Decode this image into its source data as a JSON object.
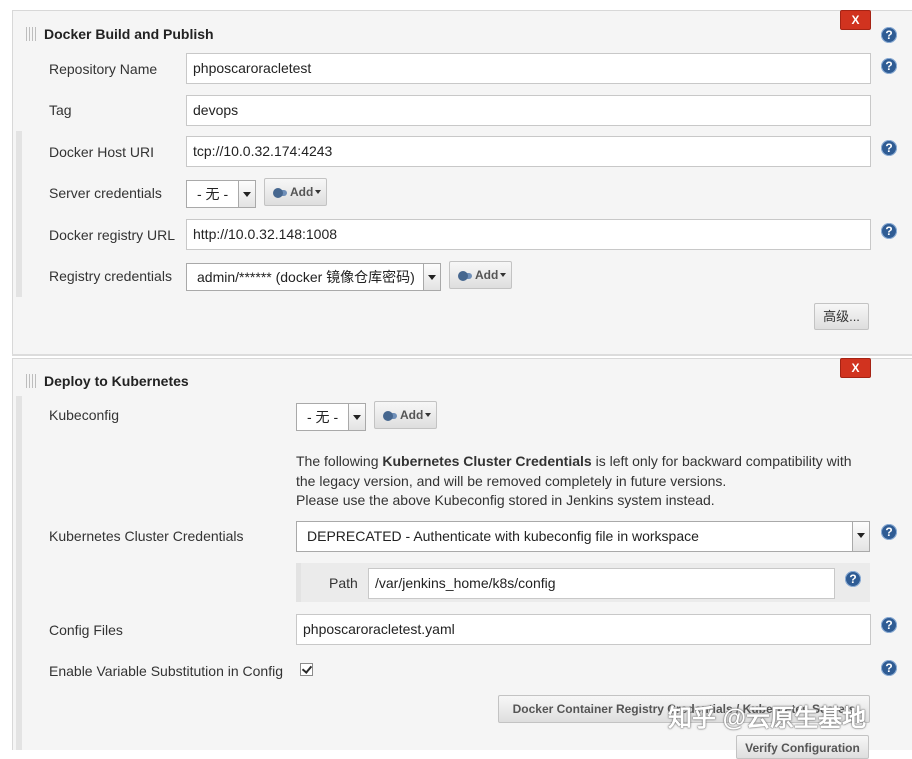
{
  "colors": {
    "accent": "#2f5c94",
    "delete": "#d1331f",
    "panel": "#f5f5f5"
  },
  "docker_section": {
    "title": "Docker Build and Publish",
    "delete_label": "X",
    "repository_name": {
      "label": "Repository Name",
      "value": "phposcaroracletest"
    },
    "tag": {
      "label": "Tag",
      "value": "devops"
    },
    "docker_host_uri": {
      "label": "Docker Host URI",
      "value": "tcp://10.0.32.174:4243"
    },
    "server_credentials": {
      "label": "Server credentials",
      "selected": "- 无 -",
      "add_label": "Add"
    },
    "docker_registry_url": {
      "label": "Docker registry URL",
      "value": "http://10.0.32.148:1008"
    },
    "registry_credentials": {
      "label": "Registry credentials",
      "selected": "admin/****** (docker 镜像仓库密码)",
      "add_label": "Add"
    },
    "advanced_label": "高级..."
  },
  "k8s_section": {
    "title": "Deploy to Kubernetes",
    "delete_label": "X",
    "kubeconfig": {
      "label": "Kubeconfig",
      "selected": "- 无 -",
      "add_label": "Add"
    },
    "note": {
      "prefix": "The following ",
      "bold": "Kubernetes Cluster Credentials",
      "line1_suffix": " is left only for backward compatibility with",
      "line2": "the legacy version, and will be removed completely in future versions.",
      "line3": "Please use the above Kubeconfig stored in Jenkins system instead."
    },
    "cluster_credentials": {
      "label": "Kubernetes Cluster Credentials",
      "selected": "DEPRECATED - Authenticate with kubeconfig file in workspace"
    },
    "path": {
      "label": "Path",
      "value": "/var/jenkins_home/k8s/config"
    },
    "config_files": {
      "label": "Config Files",
      "value": "phposcaroracletest.yaml"
    },
    "variable_substitution": {
      "label": "Enable Variable Substitution in Config",
      "checked": true
    },
    "registry_button_label": "Docker Container Registry Credentials / Kubernetes Secrets",
    "verify_button_label": "Verify Configuration"
  },
  "help_glyph": "?",
  "watermark": "知乎 @云原生基地"
}
